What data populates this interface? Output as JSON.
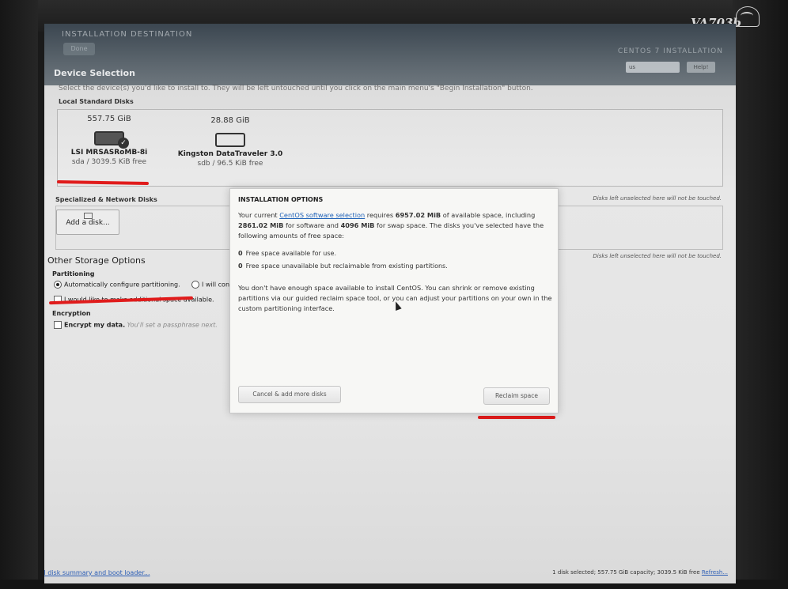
{
  "monitor": {
    "model": "VA703b"
  },
  "header": {
    "title": "INSTALLATION DESTINATION",
    "done_label": "Done",
    "product": "CENTOS 7 INSTALLATION",
    "keyboard": "us",
    "help_label": "Help!"
  },
  "device_selection": {
    "heading": "Device Selection",
    "hint": "Select the device(s) you'd like to install to. They will be left untouched until you click on the main menu's \"Begin Installation\" button.",
    "local_label": "Local Standard Disks",
    "disks": [
      {
        "capacity": "557.75 GiB",
        "name": "LSI MRSASRoMB-8i",
        "free": "sda / 3039.5 KiB free",
        "selected": true
      },
      {
        "capacity": "28.88 GiB",
        "name": "Kingston DataTraveler 3.0",
        "free": "sdb / 96.5 KiB free",
        "selected": false
      }
    ],
    "specialized_label": "Specialized & Network Disks",
    "add_disk_label": "Add a disk...",
    "unselected_note": "Disks left unselected here will not be touched."
  },
  "other_options": {
    "heading": "Other Storage Options",
    "partitioning_label": "Partitioning",
    "auto_label": "Automatically configure partitioning.",
    "custom_label": "I will configure partitioning.",
    "reclaim_label": "I would like to make additional space available.",
    "encryption_label": "Encryption",
    "encrypt_label": "Encrypt my data.",
    "encrypt_hint": "You'll set a passphrase next."
  },
  "footer": {
    "summary_link": "Full disk summary and boot loader...",
    "summary_text": "1 disk selected; 557.75 GiB capacity; 3039.5 KiB free",
    "refresh_label": "Refresh..."
  },
  "modal": {
    "title": "INSTALLATION OPTIONS",
    "text_pre": "Your current ",
    "link": "CentOS software selection",
    "text_req": " requires ",
    "required": "6957.02 MiB",
    "text_a": " of available space, including ",
    "software": "2861.02 MiB",
    "text_b": " for software and ",
    "swap": "4096 MiB",
    "text_c": " for swap space. The disks you've selected have the following amounts of free space:",
    "free_avail_value": "0",
    "free_avail_label": "Free space available for use.",
    "free_reclaim_value": "0",
    "free_reclaim_label": "Free space unavailable but reclaimable from existing partitions.",
    "note": "You don't have enough space available to install CentOS.  You can shrink or remove existing partitions via our guided reclaim space tool, or you can adjust your partitions on your own in the custom partitioning interface.",
    "cancel_label": "Cancel & add more disks",
    "reclaim_label": "Reclaim space"
  },
  "colors": {
    "marker": "#e01b1b",
    "link": "#1f62b8"
  }
}
